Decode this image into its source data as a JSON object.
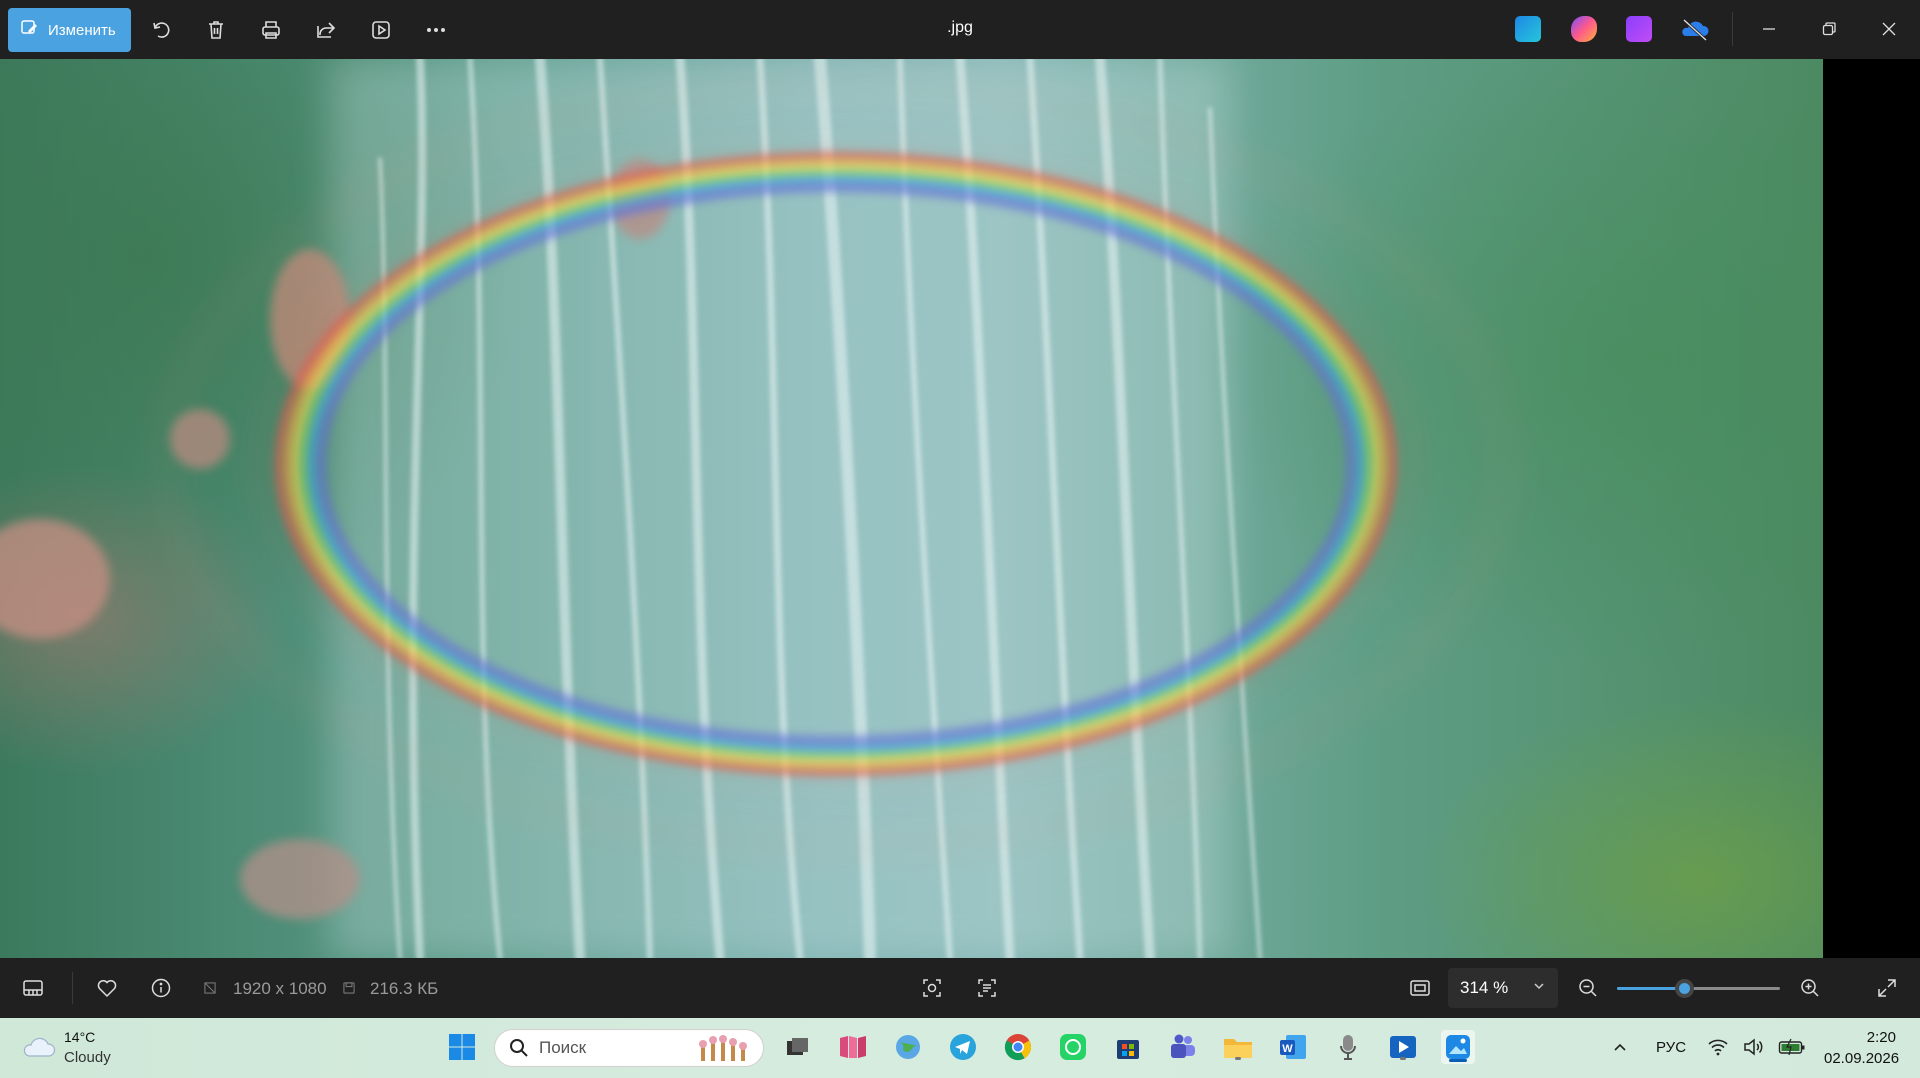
{
  "toolbar": {
    "edit_label": "Изменить",
    "file_name": ".jpg",
    "tools": [
      "rotate-icon",
      "delete-icon",
      "print-icon",
      "share-icon",
      "slideshow-icon",
      "more-icon"
    ],
    "apps": [
      "photos-editor-icon",
      "copilot-icon",
      "clipchamp-icon",
      "onedrive-off-icon"
    ]
  },
  "statusbar": {
    "dimensions": "1920 x 1080",
    "file_size": "216.3 КБ",
    "zoom": "314 %",
    "zoom_level_fraction": 0.41,
    "icons": [
      "filmstrip-icon",
      "favorite-icon",
      "info-icon",
      "visual-search-icon",
      "text-scan-icon",
      "fit-to-window-icon",
      "zoom-out-icon",
      "zoom-in-icon",
      "fullscreen-icon"
    ]
  },
  "taskbar": {
    "weather_temp": "14°C",
    "weather_desc": "Cloudy",
    "search_placeholder": "Поиск",
    "apps": [
      "task-view",
      "bookmarks-app",
      "globe-app",
      "telegram",
      "chrome",
      "whatsapp",
      "store",
      "teams",
      "file-explorer",
      "word",
      "microphone-app",
      "media-player",
      "photos"
    ],
    "language": "РУС",
    "time": "2:20",
    "date": "02.09.2026"
  },
  "colors": {
    "accent": "#4aa3e0",
    "toolbar_bg": "#202020",
    "taskbar_bg": "#d3eadc"
  }
}
